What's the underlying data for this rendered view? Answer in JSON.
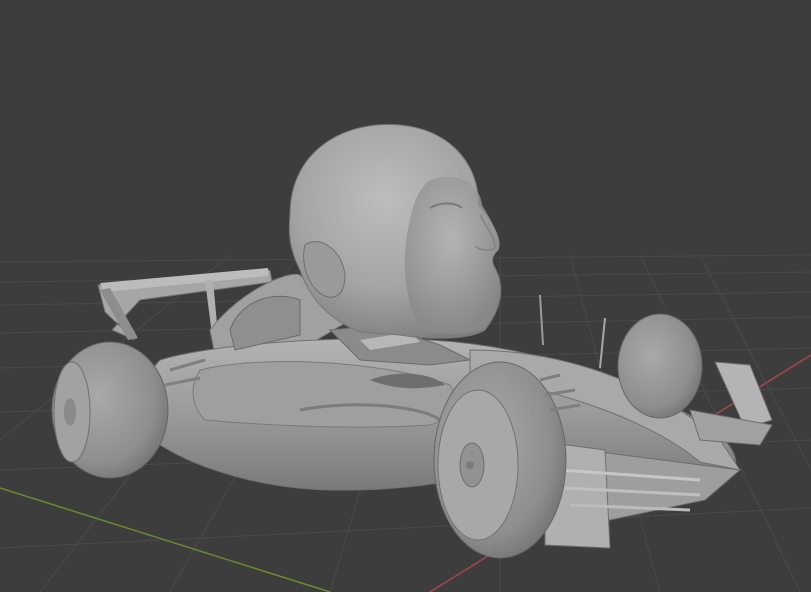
{
  "viewport": {
    "background_color": "#3d3d3d",
    "grid_line_color": "#4a4a4a",
    "x_axis_color": "#a5464d",
    "y_axis_color": "#6a8b2a",
    "model_base_color": "#9c9c9c"
  },
  "scene": {
    "objects": [
      "head-model",
      "f1-car-model"
    ]
  }
}
